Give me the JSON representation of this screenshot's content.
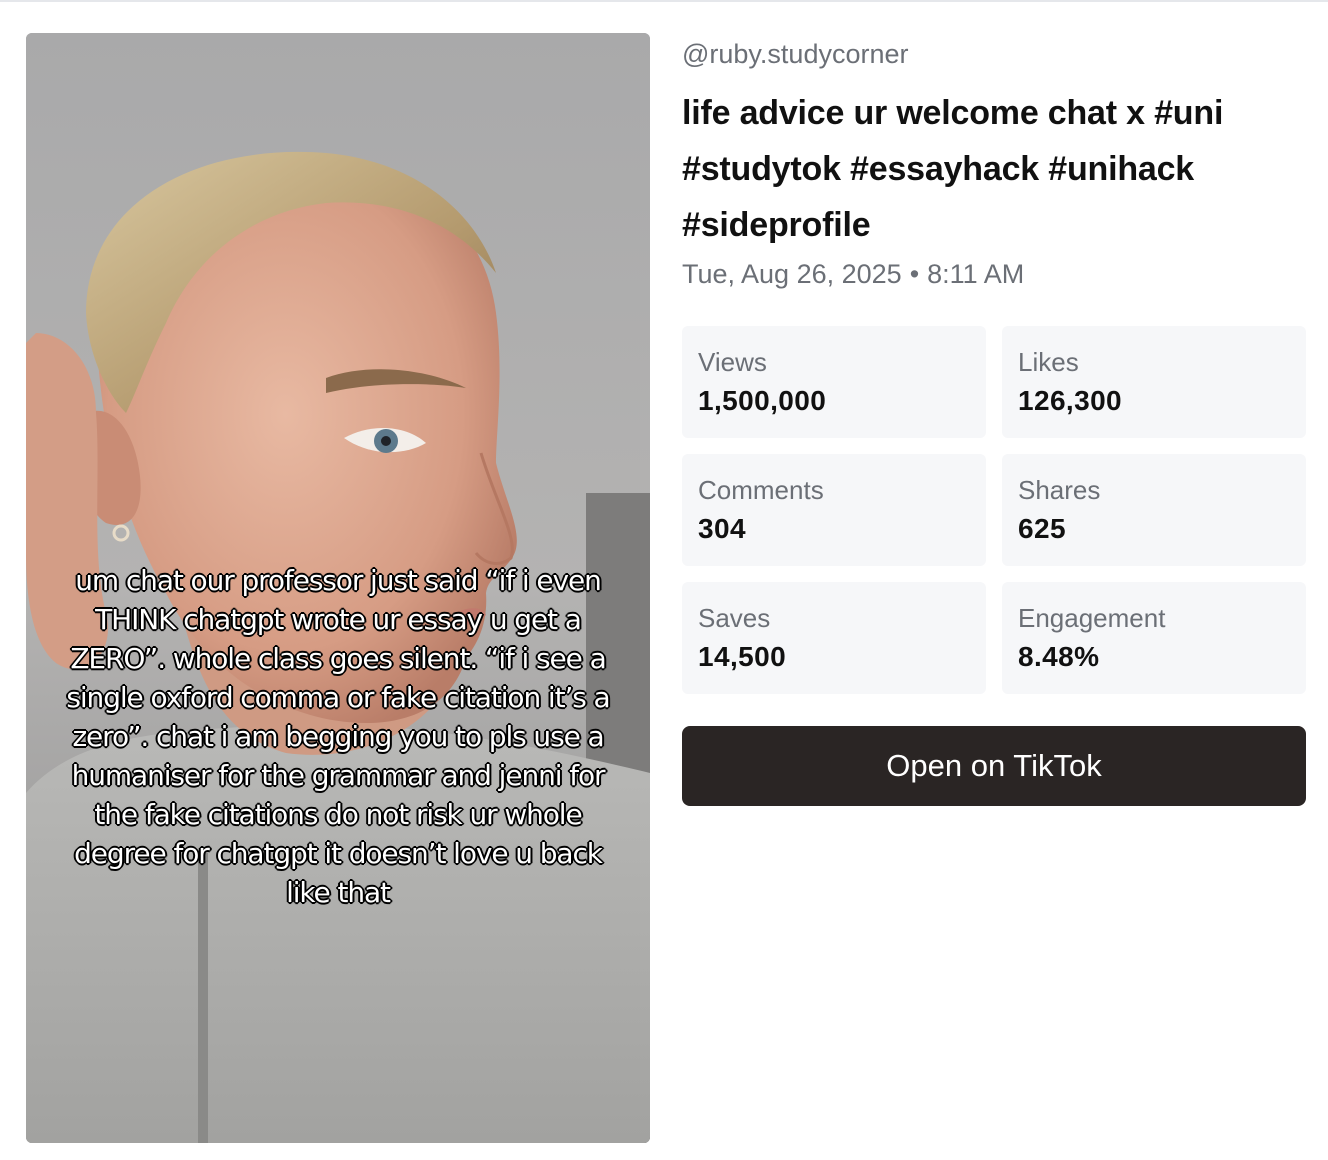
{
  "video": {
    "caption": "um chat our professor just said “if i even THINK chatgpt wrote ur essay u get a ZERO”. whole class goes silent. “if i see a single oxford comma or fake citation it’s a zero”. chat i am begging you to pls use a humaniser for the grammar and jenni for the fake citations do not risk ur whole degree for chatgpt it doesn’t love u back like that"
  },
  "post": {
    "handle": "@ruby.studycorner",
    "title": "life advice ur welcome chat x #uni #studytok #essayhack #unihack #sideprofile",
    "date": "Tue, Aug 26, 2025",
    "separator": "•",
    "time": "8:11 AM"
  },
  "stats": [
    {
      "label": "Views",
      "value": "1,500,000"
    },
    {
      "label": "Likes",
      "value": "126,300"
    },
    {
      "label": "Comments",
      "value": "304"
    },
    {
      "label": "Shares",
      "value": "625"
    },
    {
      "label": "Saves",
      "value": "14,500"
    },
    {
      "label": "Engagement",
      "value": "8.48%"
    }
  ],
  "actions": {
    "open_label": "Open on TikTok"
  }
}
